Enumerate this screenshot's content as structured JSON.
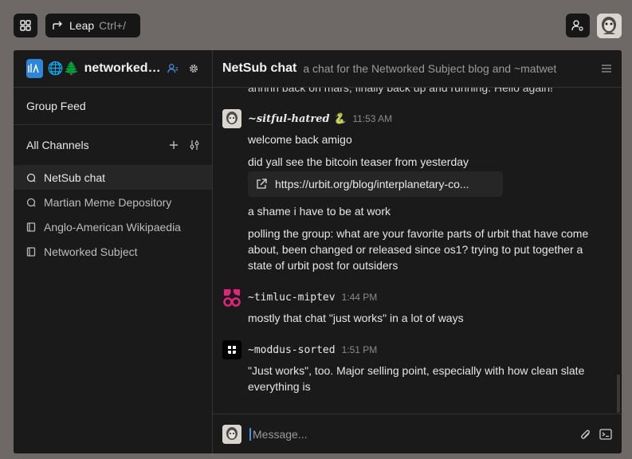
{
  "topbar": {
    "leap_label": "Leap",
    "leap_shortcut": "Ctrl+/"
  },
  "group": {
    "title": "networked subject"
  },
  "sidebar": {
    "group_feed": "Group Feed",
    "all_channels": "All Channels",
    "channels": [
      {
        "label": "NetSub chat",
        "icon": "chat-bubble-icon"
      },
      {
        "label": "Martian Meme Depository",
        "icon": "chat-bubble-icon"
      },
      {
        "label": "Anglo-American Wikipaedia",
        "icon": "notebook-icon"
      },
      {
        "label": "Networked Subject",
        "icon": "notebook-icon"
      }
    ]
  },
  "chat": {
    "title": "NetSub chat",
    "description": "a chat for the Networked Subject blog and ~matwet",
    "cut_line": "ahhhh back on mars, finally back up and running. Hello again!",
    "messages": [
      {
        "author": "~sitful-hatred 🐍",
        "time": "11:53 AM",
        "lines": [
          "welcome back amigo",
          "did yall see the bitcoin teaser from yesterday"
        ],
        "link": "https://urbit.org/blog/interplanetary-co...",
        "more": [
          "a shame i have to be at work",
          "polling the group: what are your favorite parts of urbit that have come about, been changed or released since os1? trying to put together a state of urbit post for outsiders"
        ]
      },
      {
        "author": "~timluc-miptev",
        "time": "1:44 PM",
        "lines": [
          "mostly that chat \"just works\" in a lot of ways"
        ]
      },
      {
        "author": "~moddus-sorted",
        "time": "1:51 PM",
        "lines": [
          "\"Just works\", too. Major selling point, especially with how clean slate everything is"
        ]
      }
    ]
  },
  "composer": {
    "placeholder": "Message..."
  },
  "colors": {
    "accent": "#4a90e2",
    "group_logo": "#2f86d6",
    "background": "#1a1a1a"
  }
}
